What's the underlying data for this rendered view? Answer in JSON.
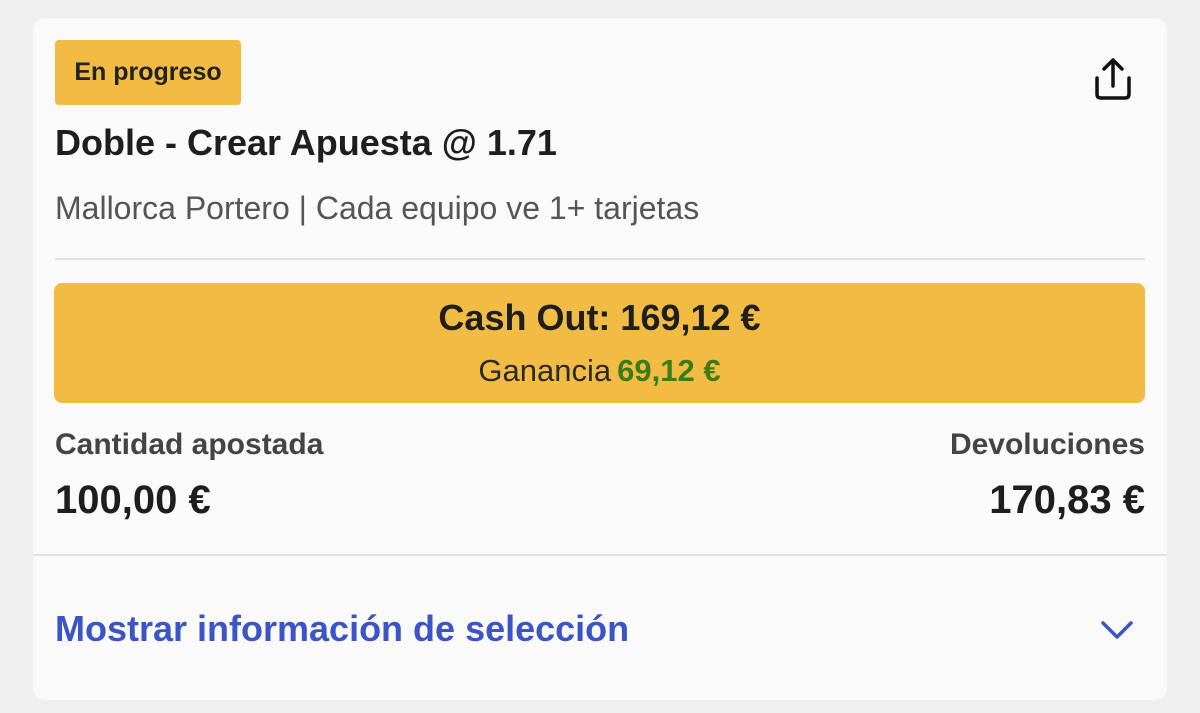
{
  "status": {
    "label": "En progreso",
    "color": "#f2bb44"
  },
  "share": {
    "icon": "share-icon"
  },
  "bet": {
    "title": "Doble - Crear Apuesta @ 1.71",
    "selections": "Mallorca Portero | Cada equipo ve 1+ tarjetas"
  },
  "cashout": {
    "label": "Cash Out: 169,12 €",
    "profit_label": "Ganancia",
    "profit_value": "69,12 €",
    "button_color": "#f2bb44",
    "profit_color": "#3d7a18"
  },
  "stake": {
    "label": "Cantidad apostada",
    "value": "100,00 €"
  },
  "returns": {
    "label": "Devoluciones",
    "value": "170,83 €"
  },
  "selection_info": {
    "label": "Mostrar información de selección",
    "icon": "chevron-down-icon",
    "color": "#3b54c6"
  }
}
